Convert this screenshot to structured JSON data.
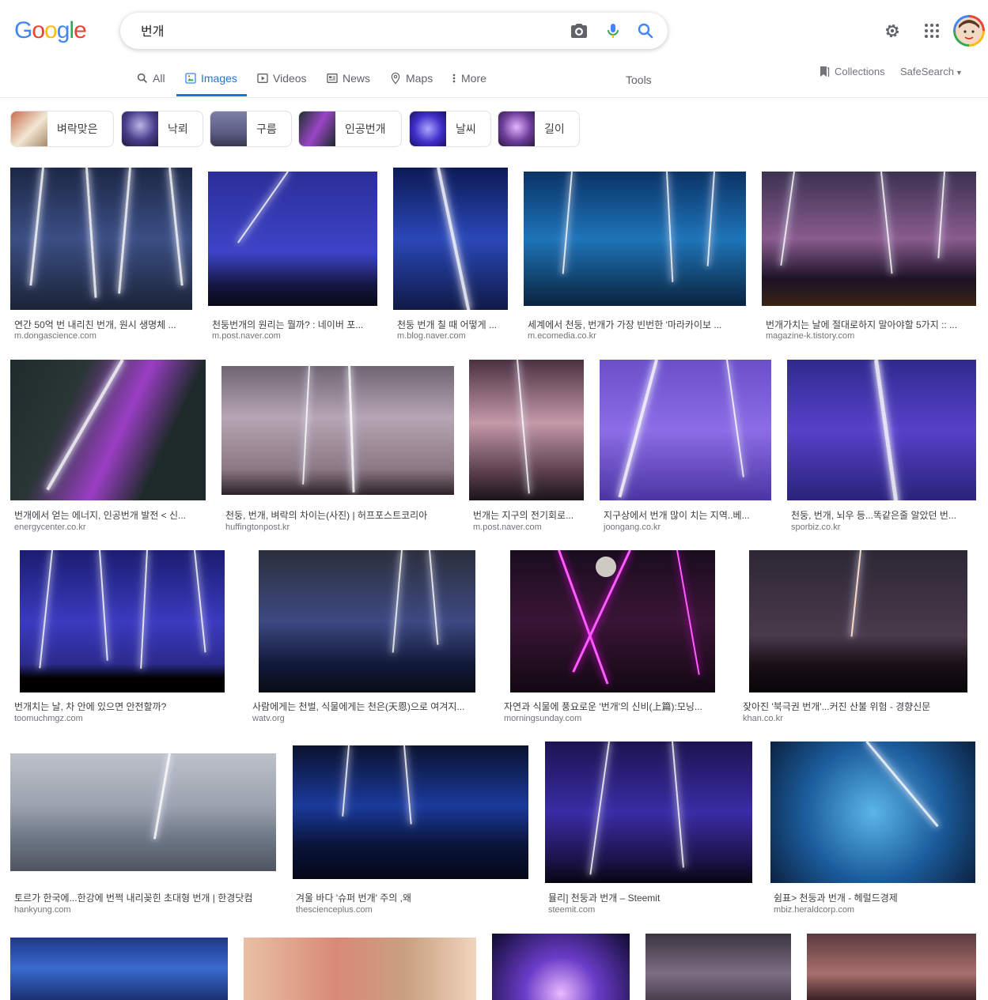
{
  "logo": [
    "G",
    "o",
    "o",
    "g",
    "l",
    "e"
  ],
  "logo_colors": [
    "#4285f4",
    "#ea4335",
    "#fbbc05",
    "#4285f4",
    "#34a853",
    "#ea4335"
  ],
  "search": {
    "value": "번개"
  },
  "tabs": [
    {
      "label": "All",
      "icon": "search-icon"
    },
    {
      "label": "Images",
      "icon": "image-icon"
    },
    {
      "label": "Videos",
      "icon": "play-icon"
    },
    {
      "label": "News",
      "icon": "news-icon"
    },
    {
      "label": "Maps",
      "icon": "map-pin-icon"
    },
    {
      "label": "More",
      "icon": "more-vert-icon"
    }
  ],
  "tools_label": "Tools",
  "collections_label": "Collections",
  "safesearch_label": "SafeSearch",
  "chips": [
    "벼락맞은",
    "낙뢰",
    "구름",
    "인공번개",
    "날씨",
    "길이"
  ],
  "results": [
    {
      "title": "연간 50억 번 내리친 번개, 원시 생명체 ...",
      "source": "m.dongascience.com"
    },
    {
      "title": "천둥번개의 원리는 뭘까? : 네이버 포...",
      "source": "m.post.naver.com"
    },
    {
      "title": "천둥 번개 칠 때 어떻게 ...",
      "source": "m.blog.naver.com"
    },
    {
      "title": "세계에서 천둥, 번개가 가장 빈번한 '마라카이보 ...",
      "source": "m.ecomedia.co.kr"
    },
    {
      "title": "번개가치는 날에 절대로하지 말아야할 5가지 :: ...",
      "source": "magazine-k.tistory.com"
    },
    {
      "title": "번개에서 얻는 에너지, 인공번개 발전 < 신...",
      "source": "energycenter.co.kr"
    },
    {
      "title": "천둥, 번개, 벼락의 차이는(사진) | 허프포스트코리아",
      "source": "huffingtonpost.kr"
    },
    {
      "title": "번개는 지구의 전기회로...",
      "source": "m.post.naver.com"
    },
    {
      "title": "지구상에서 번개 많이 치는 지역..베...",
      "source": "joongang.co.kr"
    },
    {
      "title": "천둥, 번개, 뇌우 등...똑같은줄 알았던 번...",
      "source": "sporbiz.co.kr"
    },
    {
      "title": "번개치는 날, 차 안에 있으면 안전할까?",
      "source": "toomuchmgz.com"
    },
    {
      "title": "사람에게는 천벌, 식물에게는 천은(天恩)으로 여겨지...",
      "source": "watv.org"
    },
    {
      "title": "자연과 식물에 풍요로운 '번개'의 신비(上篇):모닝...",
      "source": "morningsunday.com"
    },
    {
      "title": "잦아진 '북극권 번개'...커진 산불 위험 - 경향신문",
      "source": "khan.co.kr"
    },
    {
      "title": "토르가 한국에...한강에 번쩍 내리꽂힌 초대형 번개 | 한경닷컴",
      "source": "hankyung.com"
    },
    {
      "title": "겨울 바다 '슈퍼 번개' 주의 ,왜",
      "source": "thescienceplus.com"
    },
    {
      "title": "뮬리] 천둥과 번개 – Steemit",
      "source": "steemit.com"
    },
    {
      "title": "쉼표> 천둥과 번개 - 헤럴드경제",
      "source": "mbiz.heraldcorp.com"
    }
  ]
}
